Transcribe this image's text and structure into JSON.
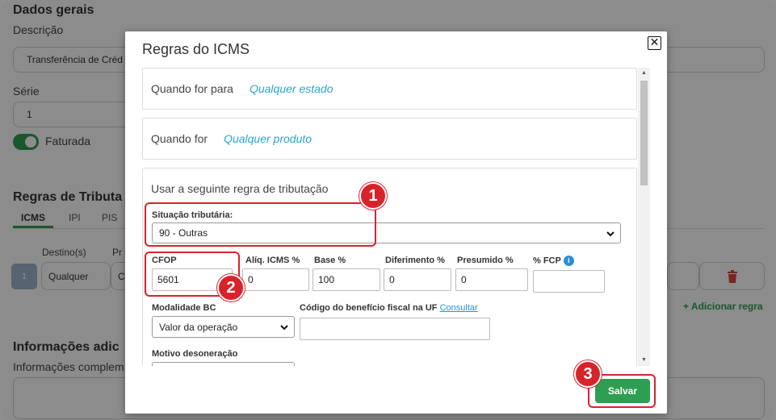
{
  "background": {
    "section_title": "Dados gerais",
    "descricao_label": "Descrição",
    "descricao_value": "Transferência de Créd",
    "serie_label": "Série",
    "serie_value": "1",
    "faturada_label": "Faturada",
    "regras_title": "Regras de Tributa",
    "tabs": [
      "ICMS",
      "IPI",
      "PIS"
    ],
    "col_destinos": "Destino(s)",
    "col_pr": "Pr",
    "row_num": "1",
    "row_destino": "Qualquer",
    "row_c": "C",
    "add_rule": "+ Adicionar regra",
    "info_title": "Informações adic",
    "info_label": "Informações complem"
  },
  "modal": {
    "title": "Regras do ICMS",
    "close_label": "✕",
    "quando_para_label": "Quando for para",
    "quando_para_link": "Qualquer estado",
    "quando_for_label": "Quando for",
    "quando_for_link": "Qualquer produto",
    "usar_regra_label": "Usar a seguinte regra de tributação",
    "situacao_label": "Situação tributária:",
    "situacao_value": "90 - Outras",
    "cfop_label": "CFOP",
    "cfop_value": "5601",
    "aliq_label": "Alíq. ICMS %",
    "aliq_value": "0",
    "base_label": "Base %",
    "base_value": "100",
    "diferimento_label": "Diferimento %",
    "diferimento_value": "0",
    "presumido_label": "Presumido %",
    "presumido_value": "0",
    "fcp_label": "% FCP",
    "fcp_info": "i",
    "fcp_value": "",
    "modalidade_label": "Modalidade BC",
    "modalidade_value": "Valor da operação",
    "codigo_label": "Código do benefício fiscal na UF",
    "consultar_link": "Consultar",
    "codigo_value": "",
    "motivo_label": "Motivo desoneração",
    "save_label": "Salvar"
  },
  "callouts": [
    "1",
    "2",
    "3"
  ],
  "colors": {
    "accent_green": "#2e9e52",
    "link_blue": "#2ba4cf",
    "callout_red": "#d9232b"
  }
}
